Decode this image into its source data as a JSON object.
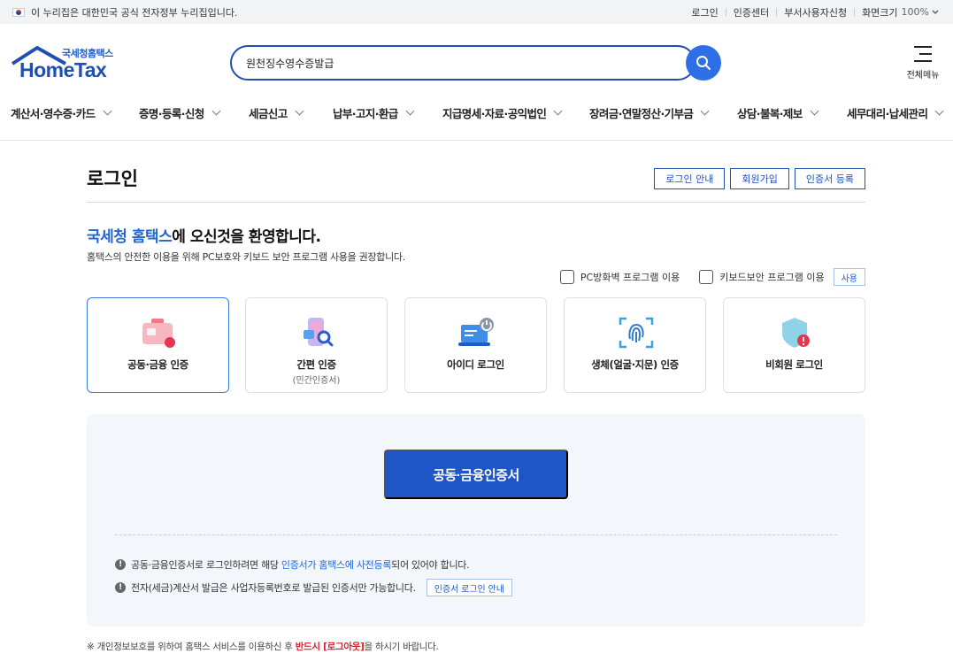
{
  "gov_banner": {
    "text": "이 누리집은 대한민국 공식 전자정부 누리집입니다.",
    "links": [
      "로그인",
      "인증센터",
      "부서사용자신청"
    ],
    "zoom_label": "화면크기",
    "zoom_value": "100%"
  },
  "header": {
    "logo_sub": "국세청홈택스",
    "logo_main": "HomeTax",
    "search_value": "원천징수영수증발급",
    "all_menu_label": "전체메뉴"
  },
  "nav": [
    "계산서·영수증·카드",
    "증명·등록·신청",
    "세금신고",
    "납부·고지·환급",
    "지급명세·자료·공익법인",
    "장려금·연말정산·기부금",
    "상담·불복·제보",
    "세무대리·납세관리"
  ],
  "main": {
    "title": "로그인",
    "title_buttons": [
      "로그인 안내",
      "회원가입",
      "인증서 등록"
    ],
    "welcome_highlight": "국세청 홈택스",
    "welcome_rest": "에 오신것을 환영합니다.",
    "welcome_sub": "홈택스의 안전한 이용을 위해 PC보호와 키보드 보안 프로그램 사용을 권장합니다.",
    "security_options": [
      "PC방화벽 프로그램 이용",
      "키보드보안 프로그램 이용"
    ],
    "use_button": "사용",
    "methods": [
      {
        "label": "공동·금융 인증",
        "sub": "",
        "icon": "certificate-card-icon"
      },
      {
        "label": "간편 인증",
        "sub": "(민간인증서)",
        "icon": "phone-search-icon"
      },
      {
        "label": "아이디 로그인",
        "sub": "",
        "icon": "laptop-power-icon"
      },
      {
        "label": "생체(얼굴·지문) 인증",
        "sub": "",
        "icon": "fingerprint-icon"
      },
      {
        "label": "비회원 로그인",
        "sub": "",
        "icon": "shield-icon"
      }
    ],
    "cert_button": "공동·금융인증서",
    "notice1_pre": "공동·금융인증서로 로그인하려면 해당 ",
    "notice1_link": "인증서가 홈택스에 사전등록",
    "notice1_post": "되어 있어야 합니다.",
    "notice2": "전자(세금)계산서 발급은 사업자등록번호로 발급된 인증서만 가능합니다.",
    "notice2_button": "인증서 로그인 안내",
    "footer_pre": "※  개인정보보호를 위하여 홈택스 서비스를 이용하신 후 ",
    "footer_red": "반드시 [로그아웃]",
    "footer_post": "을 하시기 바랍니다."
  },
  "colors": {
    "primary": "#1f56c5",
    "accent": "#2366d1",
    "warning": "#d2232a"
  }
}
